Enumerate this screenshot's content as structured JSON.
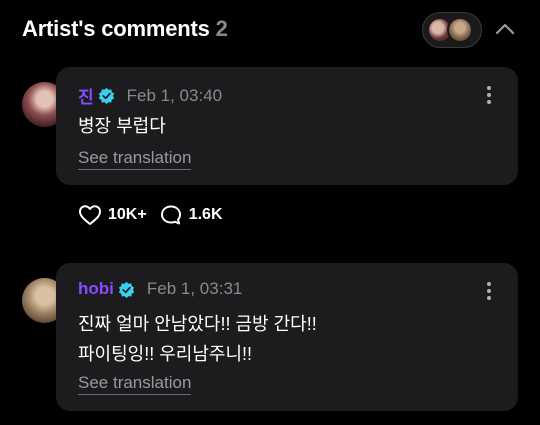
{
  "header": {
    "title": "Artist's comments",
    "count": "2"
  },
  "comments": [
    {
      "author": "진",
      "date": "Feb 1, 03:40",
      "lines": [
        "병장 부럽다"
      ],
      "translate_label": "See translation",
      "likes": "10K+",
      "replies": "1.6K"
    },
    {
      "author": "hobi",
      "date": "Feb 1, 03:31",
      "lines": [
        "진짜 얼마 안남았다!! 금방 간다!!",
        "파이팅잉!! 우리남주니!!"
      ],
      "translate_label": "See translation"
    }
  ],
  "colors": {
    "background": "#000000",
    "bubble": "#1c1c1e",
    "author": "#8a4bff",
    "verified": "#3ad0f0",
    "muted": "#8a8a8e"
  },
  "icons": {
    "like": "heart-icon",
    "reply": "speech-bubble-icon",
    "more": "more-vertical-icon",
    "collapse": "chevron-up-icon",
    "verified": "verified-badge-icon"
  }
}
